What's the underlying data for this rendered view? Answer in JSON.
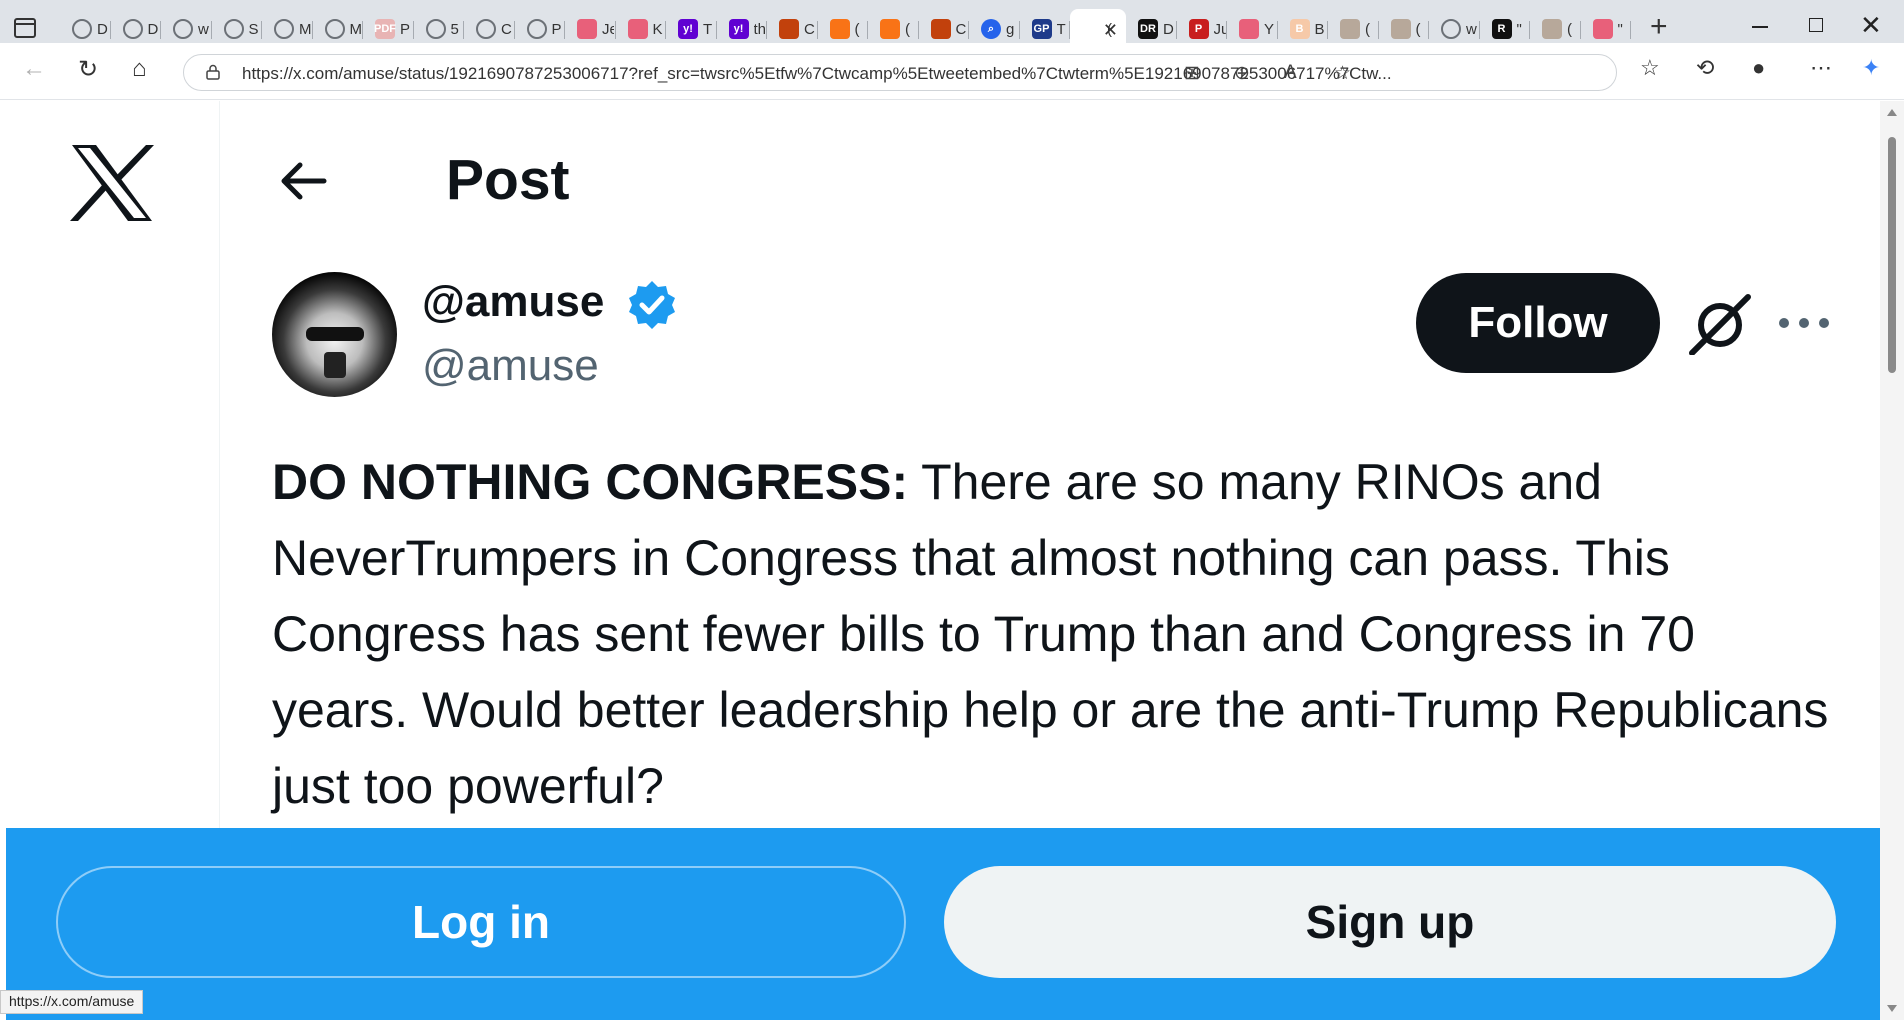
{
  "browser": {
    "tabs": [
      {
        "icon": "globe-icon",
        "label": "D"
      },
      {
        "icon": "globe-icon",
        "label": "D"
      },
      {
        "icon": "blocked-globe-icon",
        "label": "w"
      },
      {
        "icon": "globe-icon",
        "label": "S"
      },
      {
        "icon": "globe-icon",
        "label": "M"
      },
      {
        "icon": "globe-icon",
        "label": "M"
      },
      {
        "icon": "pdf-icon",
        "label": "P"
      },
      {
        "icon": "globe-icon",
        "label": "5"
      },
      {
        "icon": "globe-icon",
        "label": "C"
      },
      {
        "icon": "globe-icon",
        "label": "P"
      },
      {
        "icon": "youtube-icon",
        "label": "Je"
      },
      {
        "icon": "youtube-icon",
        "label": "K"
      },
      {
        "icon": "yahoo-icon",
        "label": "T"
      },
      {
        "icon": "yahoo-icon",
        "label": "th"
      },
      {
        "icon": "site-icon",
        "label": "C"
      },
      {
        "icon": "bookmark-icon",
        "label": "("
      },
      {
        "icon": "bookmark-icon",
        "label": "("
      },
      {
        "icon": "site-icon",
        "label": "C"
      },
      {
        "icon": "search-icon",
        "label": "g"
      },
      {
        "icon": "gp-icon",
        "label": "T"
      },
      {
        "icon": "x-icon",
        "label": "("
      },
      {
        "icon": "dr-icon",
        "label": "D"
      },
      {
        "icon": "p-icon",
        "label": "Ju"
      },
      {
        "icon": "youtube-icon",
        "label": "Y"
      },
      {
        "icon": "b-icon",
        "label": "B"
      },
      {
        "icon": "photo-icon",
        "label": "("
      },
      {
        "icon": "photo-icon",
        "label": "("
      },
      {
        "icon": "blocked-globe-icon",
        "label": "w"
      },
      {
        "icon": "r-icon",
        "label": "\""
      },
      {
        "icon": "photo-icon",
        "label": "("
      },
      {
        "icon": "youtube-icon",
        "label": "\""
      }
    ],
    "active_tab_index": 20,
    "url": "https://x.com/amuse/status/1921690787253006717?ref_src=twsrc%5Etfw%7Ctwcamp%5Etweetembed%7Ctwterm%5E1921690787253006717%7Ctw...",
    "status_url": "https://x.com/amuse"
  },
  "page": {
    "title": "Post",
    "author": {
      "display_name": "@amuse",
      "handle": "@amuse",
      "verified": true
    },
    "follow_label": "Follow",
    "tweet": {
      "lead": "DO NOTHING CONGRESS:",
      "body": " There are so many RINOs and NeverTrumpers in Congress that almost nothing can pass. This Congress has sent fewer bills to Trump than and Congress in 70 years. Would better leadership help or are the anti-Trump Republicans just too powerful?"
    },
    "login_label": "Log in",
    "signup_label": "Sign up"
  },
  "colors": {
    "brand_blue": "#1d9bf0",
    "text_primary": "#0f1419",
    "text_secondary": "#536471",
    "follow_bg": "#0f1419"
  }
}
